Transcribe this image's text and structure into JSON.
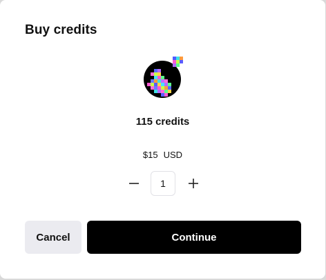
{
  "dialog": {
    "title": "Buy credits"
  },
  "product": {
    "logo_icon": "pixel-art-logo-icon",
    "credits_label": "115 credits",
    "price": "$15",
    "currency": "USD"
  },
  "quantity": {
    "value": "1",
    "decrease_icon": "minus-icon",
    "increase_icon": "plus-icon"
  },
  "actions": {
    "cancel_label": "Cancel",
    "continue_label": "Continue"
  },
  "colors": {
    "primary_button": "#000000",
    "secondary_button": "#ebebf0",
    "background": "#ffffff"
  }
}
